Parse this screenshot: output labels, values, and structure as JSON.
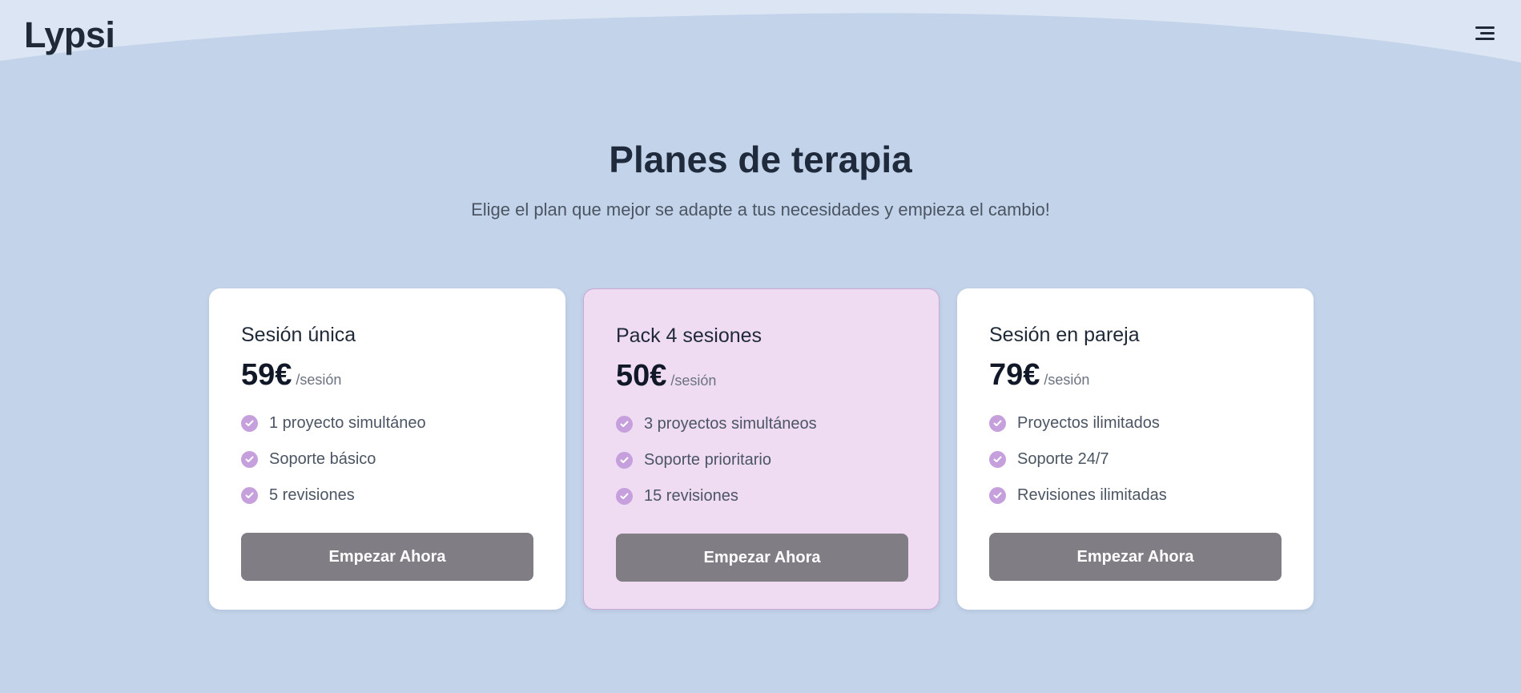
{
  "header": {
    "logo": "Lypsi",
    "menu_icon": "hamburger-menu-icon"
  },
  "hero": {
    "title": "Planes de terapia",
    "subtitle": "Elige el plan que mejor se adapte a tus necesidades y empieza el cambio!"
  },
  "plans": [
    {
      "name": "Sesión única",
      "price": "59€",
      "unit": "/sesión",
      "featured": false,
      "features": [
        "1 proyecto simultáneo",
        "Soporte básico",
        "5 revisiones"
      ],
      "cta": "Empezar Ahora"
    },
    {
      "name": "Pack 4 sesiones",
      "price": "50€",
      "unit": "/sesión",
      "featured": true,
      "features": [
        "3 proyectos simultáneos",
        "Soporte prioritario",
        "15 revisiones"
      ],
      "cta": "Empezar Ahora"
    },
    {
      "name": "Sesión en pareja",
      "price": "79€",
      "unit": "/sesión",
      "featured": false,
      "features": [
        "Proyectos ilimitados",
        "Soporte 24/7",
        "Revisiones ilimitadas"
      ],
      "cta": "Empezar Ahora"
    }
  ],
  "colors": {
    "background": "#c3d3e9",
    "header_wave": "#dce5f4",
    "featured_card": "#efdcf3",
    "check_icon": "#c6a0dc",
    "button": "#807d85"
  }
}
